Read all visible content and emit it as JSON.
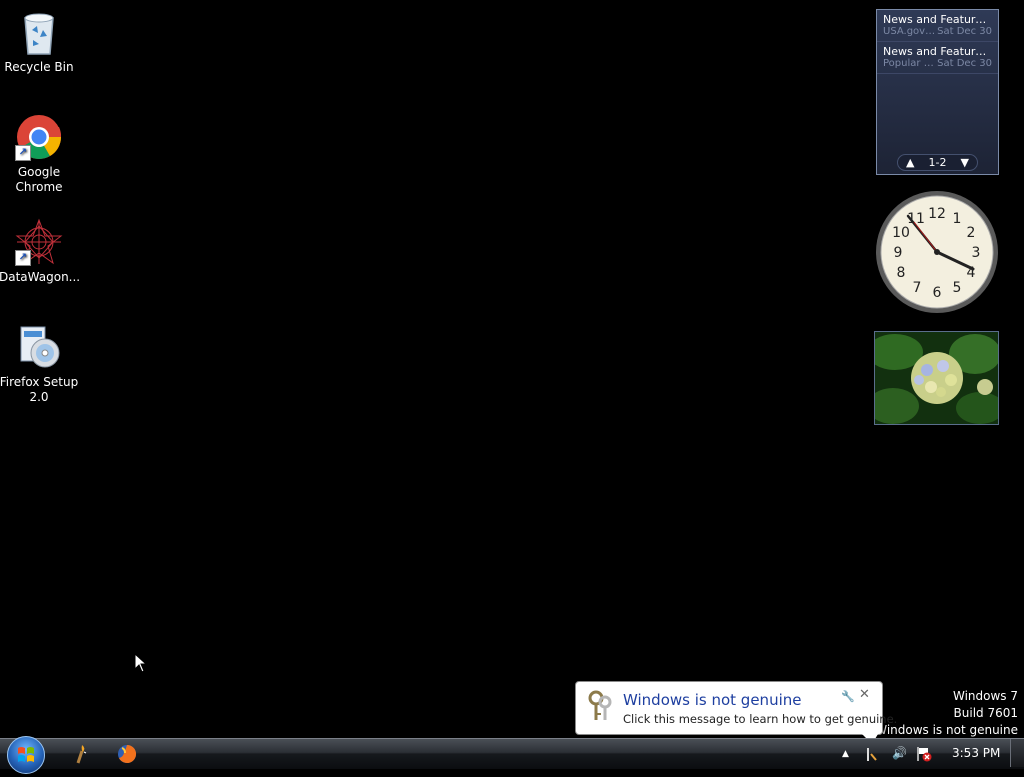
{
  "desktop": {
    "icons": [
      {
        "label": "Recycle Bin",
        "icon": "recycle-bin-icon"
      },
      {
        "label": "Google Chrome",
        "icon": "chrome-icon"
      },
      {
        "label": "DataWagon...",
        "icon": "datawagon-icon"
      },
      {
        "label": "Firefox Setup 2.0",
        "icon": "installer-icon"
      }
    ]
  },
  "gadgets": {
    "feed": {
      "items": [
        {
          "title": "News and Features f...",
          "source": "USA.gov U...",
          "date": "Sat Dec 30"
        },
        {
          "title": "News and Feature...",
          "source": "Popular G...",
          "date": "Sat Dec 30"
        }
      ],
      "page": "1-2"
    },
    "clock": {
      "numerals": [
        "12",
        "1",
        "2",
        "3",
        "4",
        "5",
        "6",
        "7",
        "8",
        "9",
        "10",
        "11"
      ]
    }
  },
  "watermark": {
    "line1": "Windows 7",
    "line2": "Build 7601",
    "line3": "This copy of Windows is not genuine",
    "line3_visible": "f Windows is not genuine"
  },
  "balloon": {
    "title": "Windows is not genuine",
    "message": "Click this message to learn how to get genuine."
  },
  "taskbar": {
    "time": "3:53 PM"
  },
  "colors": {
    "balloon_title": "#1e3fa0",
    "desktop_bg": "#000000"
  }
}
